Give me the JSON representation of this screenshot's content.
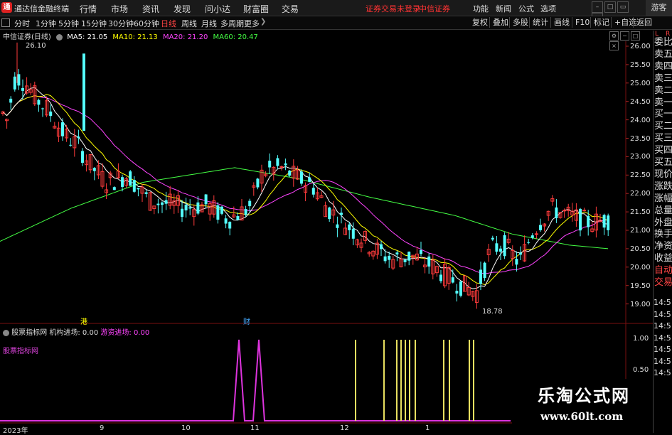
{
  "menubar": {
    "app_name": "通达信金融终端",
    "items": [
      "行情",
      "市场",
      "资讯",
      "发现",
      "问小达",
      "财富圈",
      "交易"
    ],
    "warn1": "证券交易未登录",
    "warn2": "中信证券",
    "right_items": [
      "功能",
      "新闻",
      "公式",
      "选项"
    ],
    "guest": "游客",
    "logo": "通"
  },
  "toolbar": {
    "periods": [
      "分时",
      "1分钟",
      "5分钟",
      "15分钟",
      "30分钟",
      "60分钟",
      "日线",
      "周线",
      "月线",
      "多周期",
      "更多"
    ],
    "active_period": "日线",
    "tools": [
      "复权",
      "叠加",
      "多股",
      "统计",
      "画线",
      "F10",
      "标记",
      "+自选",
      "返回"
    ]
  },
  "info": {
    "stock_title": "中信证券(日线)",
    "ma5": "MA5: 21.05",
    "ma10": "MA10: 21.13",
    "ma20": "MA20: 21.20",
    "ma60": "MA60: 20.47",
    "colors": {
      "ma5": "#ffffff",
      "ma10": "#ffff00",
      "ma20": "#ff44ff",
      "ma60": "#44ff44"
    }
  },
  "price_axis": [
    "26.00",
    "25.50",
    "25.00",
    "24.50",
    "24.00",
    "23.50",
    "23.00",
    "22.50",
    "22.00",
    "21.50",
    "21.00",
    "20.50",
    "20.00",
    "19.50",
    "19.00"
  ],
  "annotations": {
    "high": "26.10",
    "low": "18.78",
    "ex1": "港",
    "ex2": "财"
  },
  "indicator": {
    "name": "股票指标网",
    "line1": "机构进场: 0.00",
    "line2": "游资进场: 0.00",
    "label": "股票指标网",
    "axis": [
      "1.00",
      "0.50"
    ]
  },
  "date_axis": [
    "2023年",
    "9",
    "10",
    "11",
    "12",
    "1"
  ],
  "side_panel": {
    "L": "L",
    "R": "R",
    "items": [
      "委比",
      "卖五",
      "卖四",
      "卖三",
      "卖二",
      "卖一",
      "买一",
      "买二",
      "买三",
      "买四",
      "买五",
      "现价",
      "涨跌",
      "涨幅",
      "总量",
      "外盘",
      "换手",
      "净资",
      "收益",
      "自动",
      "交易"
    ],
    "times": [
      "14:5",
      "14:5",
      "14:5",
      "14:5",
      "14:5",
      "14:5",
      "14:5"
    ]
  },
  "watermark": {
    "title": "乐淘公式网",
    "url": "www.60lt.com"
  }
}
